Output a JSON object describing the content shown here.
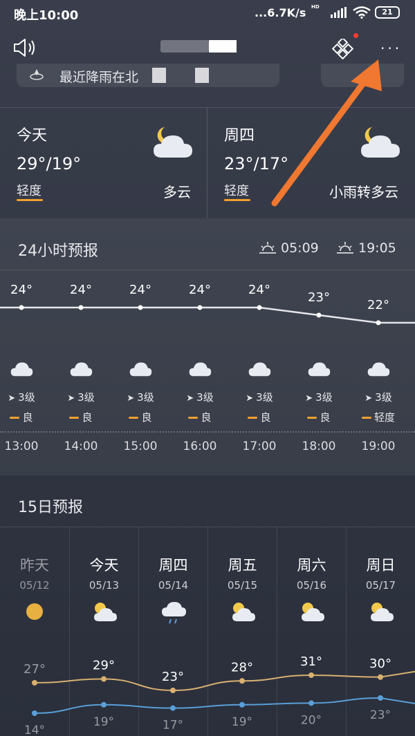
{
  "status_bar": {
    "time": "晚上10:00",
    "network_speed": "...6.7K/s",
    "hd": "HD",
    "battery": "21"
  },
  "header": {
    "speaker_icon": "speaker-icon",
    "widget_icon": "widget-icon",
    "more_icon": "more-icon",
    "more_label": "···"
  },
  "rain_notice": {
    "text": "最近降雨在北"
  },
  "day_cards": [
    {
      "name": "今天",
      "temp": "29°/19°",
      "aqi": "轻度",
      "condition": "多云",
      "icon": "partly-cloudy-night-icon"
    },
    {
      "name": "周四",
      "temp": "23°/17°",
      "aqi": "轻度",
      "condition": "小雨转多云",
      "icon": "partly-cloudy-night-icon"
    }
  ],
  "hourly": {
    "title": "24小时预报",
    "sunrise": "05:09",
    "sunset": "19:05",
    "items": [
      {
        "temp": "24°",
        "temp_value": 24,
        "wind": "3级",
        "aqi": "良",
        "time": "13:00"
      },
      {
        "temp": "24°",
        "temp_value": 24,
        "wind": "3级",
        "aqi": "良",
        "time": "14:00"
      },
      {
        "temp": "24°",
        "temp_value": 24,
        "wind": "3级",
        "aqi": "良",
        "time": "15:00"
      },
      {
        "temp": "24°",
        "temp_value": 24,
        "wind": "3级",
        "aqi": "良",
        "time": "16:00"
      },
      {
        "temp": "24°",
        "temp_value": 24,
        "wind": "3级",
        "aqi": "良",
        "time": "17:00"
      },
      {
        "temp": "23°",
        "temp_value": 23,
        "wind": "3级",
        "aqi": "良",
        "time": "18:00"
      },
      {
        "temp": "22°",
        "temp_value": 22,
        "wind": "3级",
        "aqi": "轻度",
        "time": "19:00"
      }
    ]
  },
  "daily": {
    "title": "15日预报",
    "items": [
      {
        "name": "昨天",
        "date": "05/12",
        "icon": "sunny-icon",
        "high": "27°",
        "high_value": 27,
        "low": "14°",
        "low_value": 14,
        "past": true
      },
      {
        "name": "今天",
        "date": "05/13",
        "icon": "partly-cloudy-icon",
        "high": "29°",
        "high_value": 29,
        "low": "19°",
        "low_value": 19,
        "past": false
      },
      {
        "name": "周四",
        "date": "05/14",
        "icon": "light-rain-icon",
        "high": "23°",
        "high_value": 23,
        "low": "17°",
        "low_value": 17,
        "past": false
      },
      {
        "name": "周五",
        "date": "05/15",
        "icon": "partly-cloudy-icon",
        "high": "28°",
        "high_value": 28,
        "low": "19°",
        "low_value": 19,
        "past": false
      },
      {
        "name": "周六",
        "date": "05/16",
        "icon": "partly-cloudy-icon",
        "high": "31°",
        "high_value": 31,
        "low": "20°",
        "low_value": 20,
        "past": false
      },
      {
        "name": "周日",
        "date": "05/17",
        "icon": "partly-cloudy-icon",
        "high": "30°",
        "high_value": 30,
        "low": "23°",
        "low_value": 23,
        "past": false
      }
    ]
  },
  "colors": {
    "background": "#353a47",
    "aqi_bar": "#f0a030",
    "high_line": "#d8b070",
    "low_line": "#5a9fd8",
    "annotation_arrow": "#f07830",
    "notify_dot": "#ff3b30"
  }
}
